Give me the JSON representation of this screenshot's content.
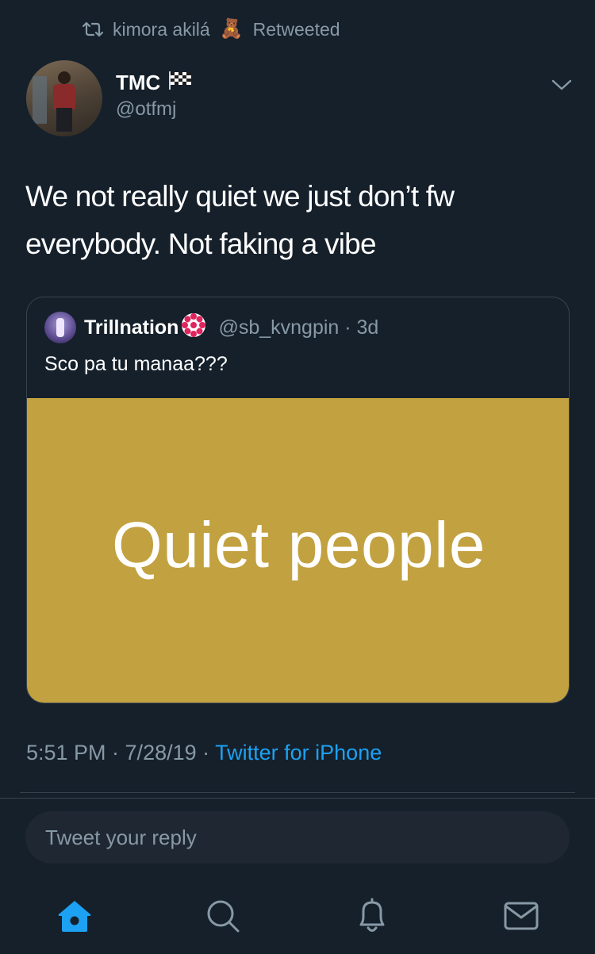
{
  "retweet": {
    "user": "kimora akilá",
    "emoji": "🧸",
    "label": "Retweeted"
  },
  "tweet": {
    "author_name": "TMC",
    "author_flag": "🏁",
    "author_handle": "@otfmj",
    "text": "We not really quiet we just don’t fw everybody. Not faking a vibe"
  },
  "quote": {
    "name": "Trillnation",
    "handle_time": "@sb_kvngpin · 3d",
    "text": "Sco pa tu manaa???",
    "image_text": "Quiet people",
    "image_bg": "#c2a140"
  },
  "meta": {
    "time_date": "5:51 PM · 7/28/19 · ",
    "source": "Twitter for iPhone"
  },
  "reply": {
    "placeholder": "Tweet your reply"
  },
  "tabbar": {
    "items": [
      "home-icon",
      "search-icon",
      "bell-icon",
      "mail-icon"
    ],
    "active": "home-icon",
    "accent": "#1da1f2",
    "inactive": "#8899a6"
  }
}
